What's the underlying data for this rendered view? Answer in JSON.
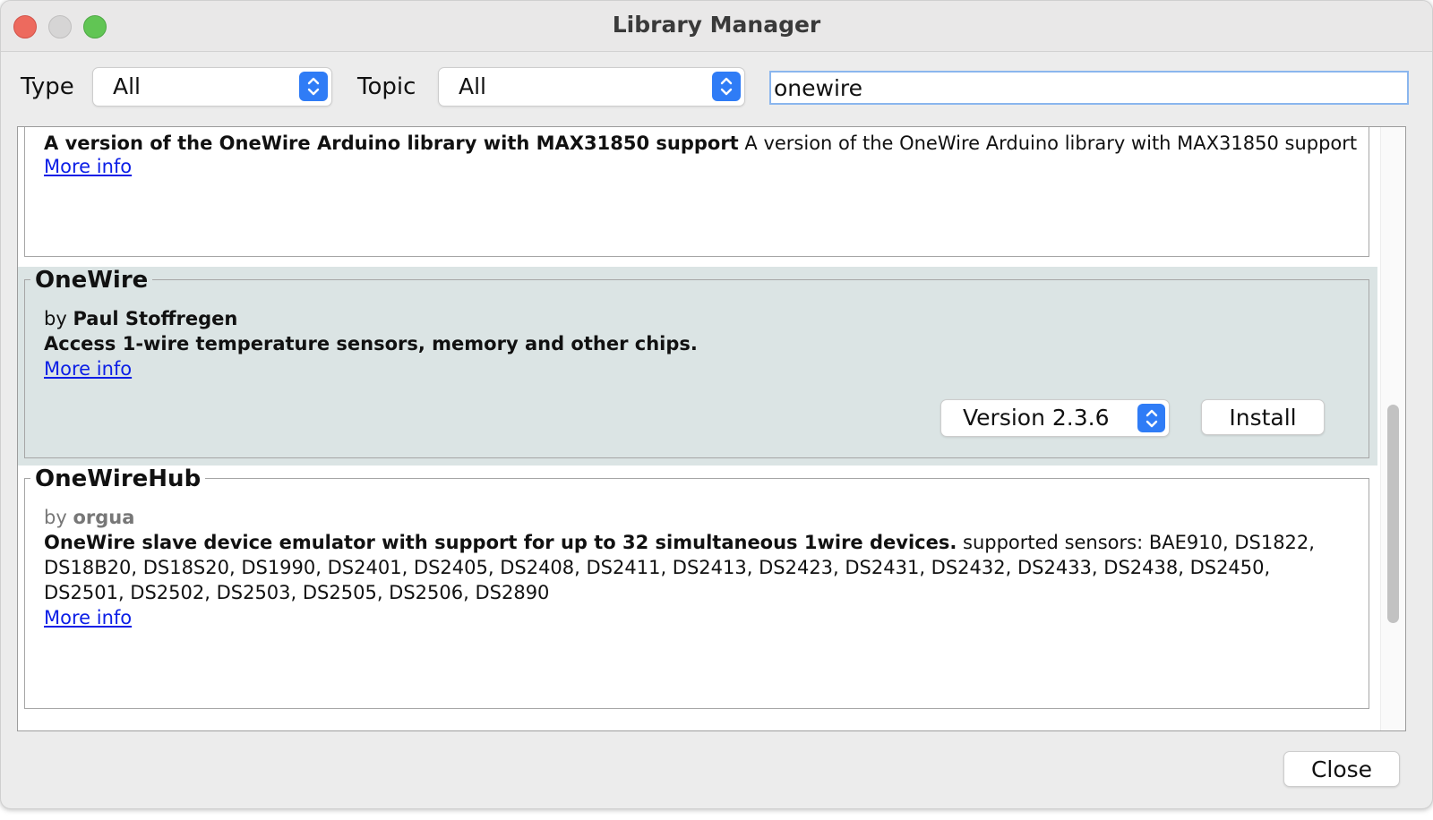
{
  "window": {
    "title": "Library Manager"
  },
  "filters": {
    "type_label": "Type",
    "type_value": "All",
    "topic_label": "Topic",
    "topic_value": "All",
    "search_value": "onewire"
  },
  "libraries": [
    {
      "name": "",
      "author": "",
      "sentence": "A version of the OneWire Arduino library with MAX31850 support",
      "paragraph": "A version of the OneWire Arduino library with MAX31850 support",
      "more_info": "More info"
    },
    {
      "name": "OneWire",
      "by": "by",
      "author": "Paul Stoffregen",
      "sentence": "Access 1-wire temperature sensors, memory and other chips.",
      "paragraph": "",
      "more_info": "More info",
      "version_label": "Version 2.3.6",
      "install_label": "Install",
      "selected": true
    },
    {
      "name": "OneWireHub",
      "by": "by",
      "author": "orgua",
      "sentence": "OneWire slave device emulator with support for up to 32 simultaneous 1wire devices.",
      "paragraph": "supported sensors: BAE910, DS1822, DS18B20, DS18S20, DS1990, DS2401, DS2405, DS2408, DS2411, DS2413, DS2423, DS2431, DS2432, DS2433, DS2438, DS2450, DS2501, DS2502, DS2503, DS2505, DS2506, DS2890",
      "more_info": "More info"
    }
  ],
  "footer": {
    "close_label": "Close"
  },
  "colors": {
    "accent": "#2f7cf6",
    "link": "#0b1ee6",
    "selected_row": "#dbe4e4"
  }
}
